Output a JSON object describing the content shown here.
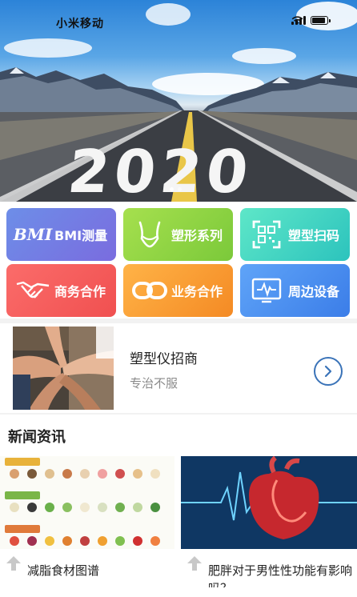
{
  "status_bar": {
    "carrier": "小米移动",
    "battery_level": 0.9
  },
  "hero": {
    "banner_text": "2020",
    "slides": 2,
    "active_slide": 1
  },
  "features": [
    {
      "glyph": "BMI",
      "label": "BMI测量",
      "icon": "bmi-icon"
    },
    {
      "label": "塑形系列",
      "icon": "body-shape-icon"
    },
    {
      "label": "塑型扫码",
      "icon": "qr-scan-icon"
    },
    {
      "label": "商务合作",
      "icon": "handshake-icon"
    },
    {
      "label": "业务合作",
      "icon": "link-icon"
    },
    {
      "label": "周边设备",
      "icon": "device-monitor-icon"
    }
  ],
  "promo": {
    "title": "塑型仪招商",
    "subtitle": "专治不服"
  },
  "news": {
    "section_title": "新闻资讯",
    "items": [
      {
        "caption": "减脂食材图谱",
        "image": "food-chart-image"
      },
      {
        "caption": "肥胖对于男性性功能有影响吗？",
        "image": "heart-ecg-image"
      }
    ]
  },
  "colors": {
    "accent": "#3a73b8",
    "bmi": "#6d8ee8",
    "shape": "#7bc93a",
    "scan": "#2cc3bd",
    "business": "#f05050",
    "service": "#f48a24",
    "device": "#3b7de8"
  }
}
